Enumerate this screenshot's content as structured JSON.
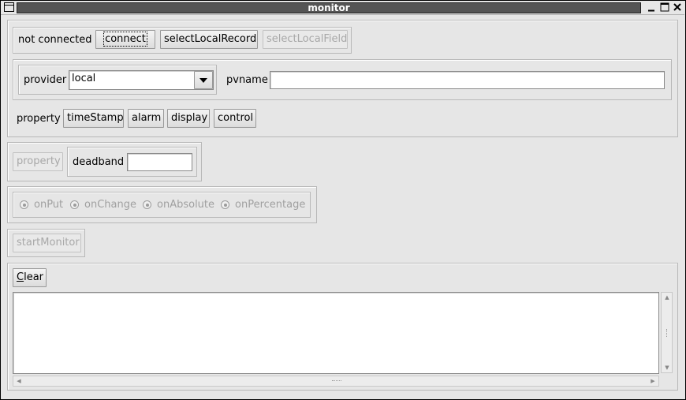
{
  "window": {
    "title": "monitor"
  },
  "connection": {
    "status": "not connected",
    "connect_label": "connect",
    "select_local_record_label": "selectLocalRecord",
    "select_local_field_label": "selectLocalField"
  },
  "provider": {
    "label": "provider",
    "value": "local"
  },
  "pvname": {
    "label": "pvname",
    "value": ""
  },
  "property_row": {
    "label": "property",
    "buttons": [
      "timeStamp",
      "alarm",
      "display",
      "control"
    ]
  },
  "deadband": {
    "property_button": "property",
    "label": "deadband",
    "value": ""
  },
  "monitor_options": [
    "onPut",
    "onChange",
    "onAbsolute",
    "onPercentage"
  ],
  "start_monitor_label": "startMonitor",
  "output": {
    "clear_label_first": "C",
    "clear_label_rest": "lear",
    "text": ""
  }
}
